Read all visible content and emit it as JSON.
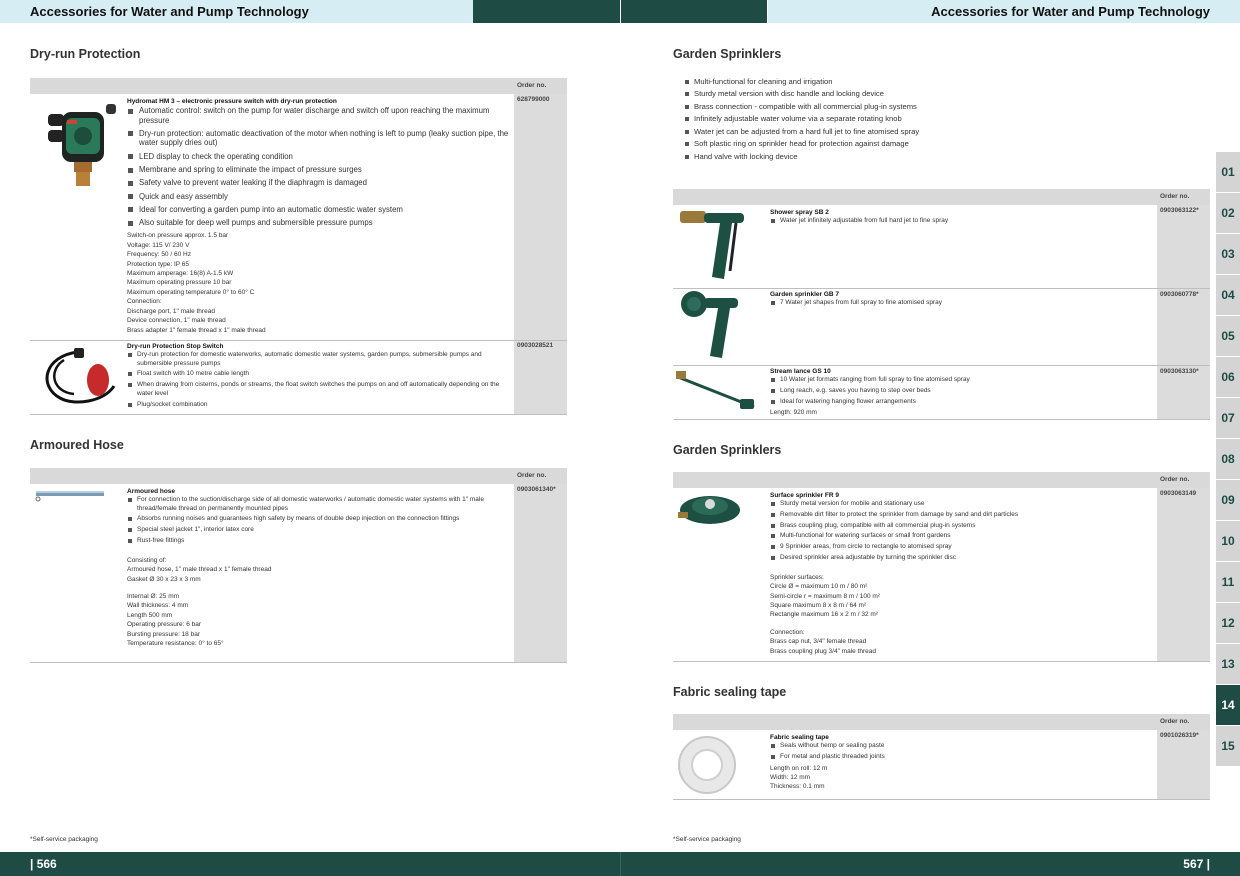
{
  "header": {
    "left_title": "Accessories for Water and Pump Technology",
    "right_title": "Accessories for Water and Pump Technology"
  },
  "footer": {
    "left_page": "| 566",
    "right_page": "567 |",
    "left_note": "*Self-service packaging",
    "right_note": "*Self-service packaging"
  },
  "order_no_label": "Order no.",
  "left": {
    "dry_run": {
      "title": "Dry-run Protection",
      "hm3": {
        "name": "Hydromat HM 3 – electronic pressure switch with dry-run protection",
        "order": "628799000",
        "bullets": [
          "Automatic control: switch on the pump for water discharge and switch off upon reaching the maximum pressure",
          "Dry-run protection: automatic deactivation of the motor when nothing is left to pump (leaky suction pipe, the water supply dries out)",
          "LED display to check the operating condition",
          "Membrane and spring to eliminate the impact of pressure surges",
          "Safety valve to prevent water leaking if the diaphragm is damaged",
          "Quick and easy assembly",
          "Ideal for converting a garden pump into an automatic domestic water system",
          "Also suitable for deep well pumps and submersible pressure pumps"
        ],
        "specs": [
          "Switch-on pressure approx. 1.5 bar",
          "Voltage: 115 V/ 230 V",
          "Frequency: 50 / 60 Hz",
          "Protection type: IP 65",
          "Maximum amperage: 16(8) A-1.5 kW",
          "Maximum operating pressure 10 bar",
          "Maximum operating temperature 0° to 60° C",
          "Connection:",
          "Discharge port, 1\" male thread",
          "Device connection, 1\" male thread",
          "Brass adapter 1\" female thread x 1\" male thread"
        ]
      },
      "stop": {
        "name": "Dry-run Protection Stop Switch",
        "order": "0903028521",
        "bullets": [
          "Dry-run protection for domestic waterworks, automatic domestic water systems, garden pumps, submersible pumps and submersible pressure pumps",
          "Float switch with 10 metre cable length",
          "When drawing from cisterns, ponds or streams, the float switch switches the pumps on and off automatically depending on the water level",
          "Plug/socket combination"
        ]
      }
    },
    "hose": {
      "title": "Armoured Hose",
      "name": "Armoured hose",
      "order": "0903061340*",
      "bullets": [
        "For connection to the suction/discharge side of all domestic waterworks / automatic domestic water systems with 1\" male thread/female thread on permanently mounted pipes",
        "Absorbs running noises and guarantees high safety by means of double deep injection on the connection fittings",
        "Special steel jacket 1\", interior latex core",
        "Rust-free fittings"
      ],
      "specs1": [
        "Consisting of:",
        "Armoured hose, 1\" male thread x 1\" female thread",
        "Gasket Ø 30 x 23 x 3 mm"
      ],
      "specs2": [
        "Internal Ø: 25 mm",
        "Wall thickness: 4 mm",
        "Length 500 mm",
        "Operating pressure: 6 bar",
        "Bursting pressure: 18 bar",
        "Temperature resistance: 0° to 65°"
      ]
    }
  },
  "right": {
    "sprinklers1": {
      "title": "Garden Sprinklers",
      "bullets": [
        "Multi-functional for cleaning and irrigation",
        "Sturdy metal version with disc handle and locking device",
        "Brass connection - compatible with all commercial plug-in systems",
        "Infinitely adjustable water volume via a separate rotating knob",
        "Water jet can be adjusted from a hard full jet to fine atomised spray",
        "Soft plastic ring on sprinkler head for protection against damage",
        "Hand valve with locking device"
      ],
      "items": [
        {
          "name": "Shower spray SB 2",
          "order": "0903063122*",
          "bullets": [
            "Water jet infinitely adjustable from full hard jet to fine spray"
          ]
        },
        {
          "name": "Garden sprinkler GB 7",
          "order": "0903060778*",
          "bullets": [
            "7 Water jet shapes from full spray to fine atomised spray"
          ]
        },
        {
          "name": "Stream lance GS 10",
          "order": "0903063130*",
          "bullets": [
            "10 Water jet formats ranging from full spray to fine atomised spray",
            "Long reach, e.g. saves you having to step over beds",
            "Ideal for watering hanging flower arrangements"
          ],
          "extra": "Length: 920 mm"
        }
      ]
    },
    "sprinklers2": {
      "title": "Garden Sprinklers",
      "name": "Surface sprinkler FR 9",
      "order": "0903063149",
      "bullets": [
        "Sturdy metal version for mobile and stationary use",
        "Removable dirt filter to protect the sprinkler from damage by sand and dirt particles",
        "Brass coupling plug, compatible with all commercial plug-in systems",
        "Multi-functional for watering surfaces or small front gardens",
        "9 Sprinkler areas, from circle to rectangle to atomised spray",
        "Desired sprinkler area adjustable by turning the sprinkler disc"
      ],
      "specs1": [
        "Sprinkler surfaces:",
        "Circle Ø = maximum 10 m / 80 m²",
        "Semi-circle r = maximum 8 m / 100 m²",
        "Square maximum 8 x 8 m / 64 m²",
        "Rectangle maximum 16 x 2 m / 32 m²"
      ],
      "specs2": [
        "Connection:",
        "Brass cap nut, 3/4\" female thread",
        "Brass coupling plug 3/4\" male thread"
      ]
    },
    "tape": {
      "title": "Fabric sealing tape",
      "name": "Fabric sealing tape",
      "order": "0901026319*",
      "bullets": [
        "Seals without hemp or sealing paste",
        "For metal and plastic threaded joints"
      ],
      "specs": [
        "Length on roll: 12 m",
        "Width: 12 mm",
        "Thickness: 0.1 mm"
      ]
    }
  },
  "tabs": [
    "01",
    "02",
    "03",
    "04",
    "05",
    "06",
    "07",
    "08",
    "09",
    "10",
    "11",
    "12",
    "13",
    "14",
    "15"
  ],
  "active_tab": "14",
  "colors": {
    "dark_green": "#1e4c45",
    "light_blue": "#d6edf4",
    "grey": "#d9d9d9"
  }
}
